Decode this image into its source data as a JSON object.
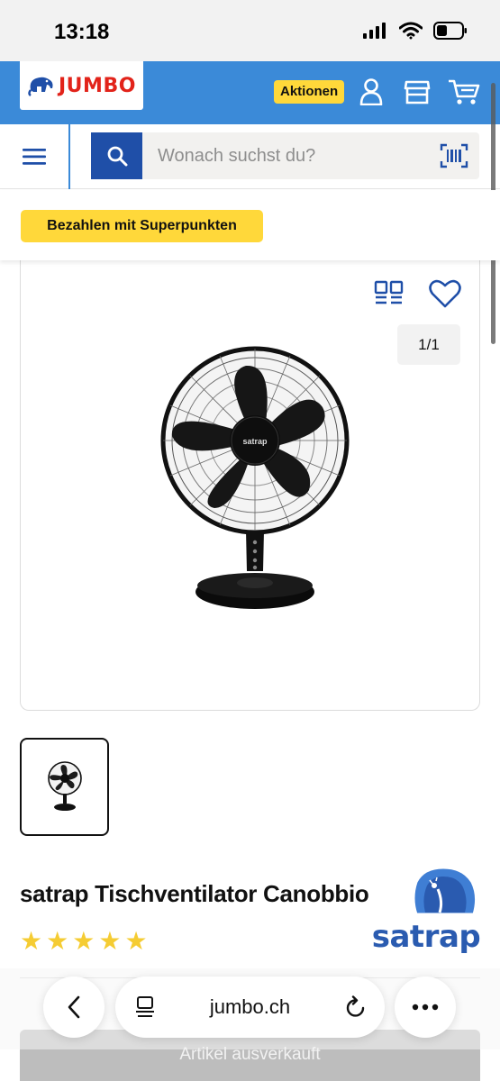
{
  "status_bar": {
    "time": "13:18"
  },
  "header": {
    "logo_text": "JUMBO",
    "aktionen_label": "Aktionen",
    "icons": [
      "account-icon",
      "store-icon",
      "cart-icon"
    ]
  },
  "search": {
    "placeholder": "Wonach suchst du?",
    "value": ""
  },
  "promo": {
    "superpunkte_label": "Bezahlen mit Superpunkten"
  },
  "gallery": {
    "counter": "1/1"
  },
  "product": {
    "title": "satrap Tischventilator Canobbio",
    "rating_stars": 5,
    "brand": "satrap",
    "fan_label": "satrap"
  },
  "buy": {
    "label": "Artikel ausverkauft"
  },
  "browser": {
    "url": "jumbo.ch"
  },
  "colors": {
    "header_blue": "#3b8ad8",
    "accent_yellow": "#ffd83a",
    "search_button": "#1f4fa8",
    "logo_red": "#e2231a",
    "star_yellow": "#f5cc33"
  }
}
